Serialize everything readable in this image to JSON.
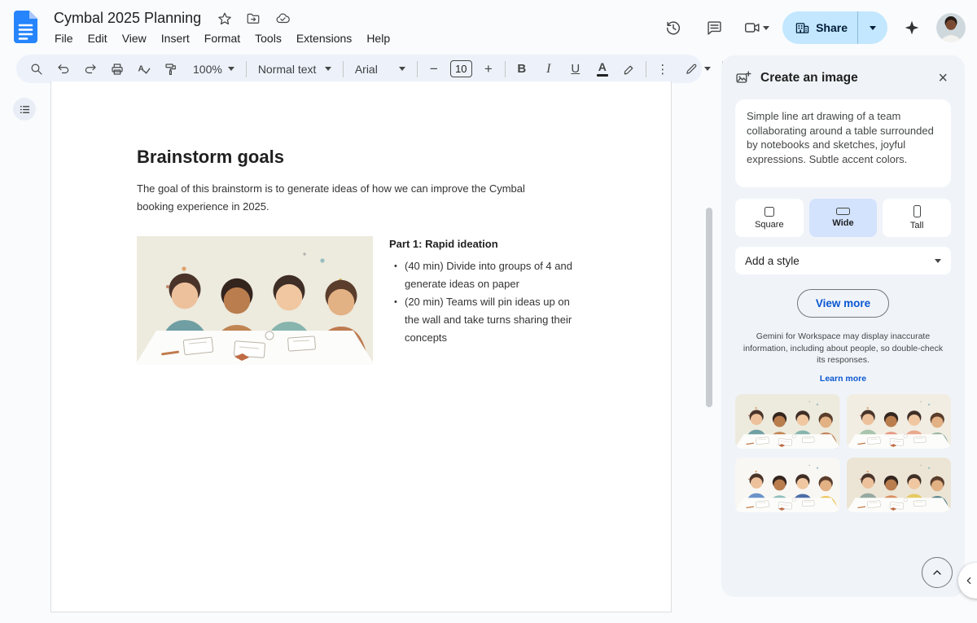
{
  "header": {
    "doc_title": "Cymbal 2025 Planning",
    "menus": [
      "File",
      "Edit",
      "View",
      "Insert",
      "Format",
      "Tools",
      "Extensions",
      "Help"
    ],
    "share_label": "Share"
  },
  "toolbar": {
    "zoom_value": "100%",
    "paragraph_style": "Normal text",
    "font_family": "Arial",
    "font_size": "10",
    "bold_glyph": "B",
    "italic_glyph": "I",
    "underline_glyph": "U",
    "text_color_glyph": "A",
    "more_glyph": "⋮"
  },
  "document": {
    "heading": "Brainstorm goals",
    "intro": "The goal of this brainstorm is to generate ideas of how we can improve the Cymbal booking experience in 2025.",
    "section_title": "Part 1: Rapid ideation",
    "bullets": [
      "(40 min) Divide into groups of 4 and generate ideas on paper",
      "(20 min) Teams will pin ideas up on the wall and take turns sharing their concepts"
    ]
  },
  "panel": {
    "title": "Create an image",
    "prompt": "Simple line art drawing of a team collaborating around a table surrounded by notebooks and sketches, joyful expressions. Subtle accent colors.",
    "aspect_options": [
      {
        "label": "Square",
        "selected": false
      },
      {
        "label": "Wide",
        "selected": true
      },
      {
        "label": "Tall",
        "selected": false
      }
    ],
    "style_dropdown": "Add a style",
    "view_more_label": "View more",
    "disclaimer": "Gemini for Workspace may display inaccurate information, including about people, so double-check its responses.",
    "learn_more_label": "Learn more"
  },
  "icons": {
    "close": "×",
    "more_vertical": "⋮"
  },
  "colors": {
    "accent_blue": "#0b57d0",
    "share_button_bg": "#c2e7ff",
    "selected_aspect_bg": "#d3e3fd",
    "toolbar_bg": "#edf2fa",
    "panel_bg": "#f0f4f9",
    "docs_logo_blue": "#2684fc"
  }
}
